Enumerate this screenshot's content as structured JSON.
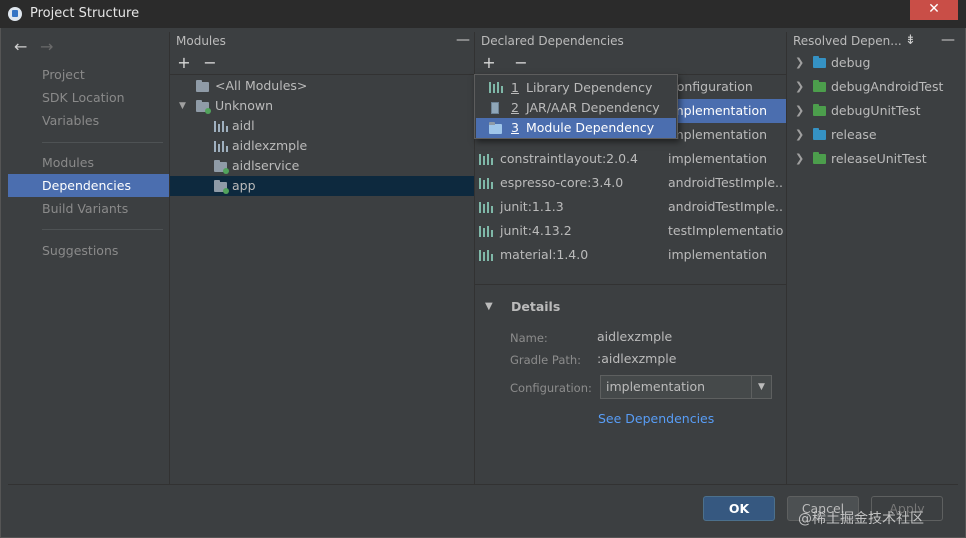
{
  "window": {
    "title": "Project Structure",
    "close_icon": "✕"
  },
  "nav": {
    "back_icon": "←",
    "forward_icon": "→",
    "items": [
      "Project",
      "SDK Location",
      "Variables",
      "Modules",
      "Dependencies",
      "Build Variants",
      "Suggestions"
    ],
    "selected": "Dependencies"
  },
  "modules_panel": {
    "header": "Modules",
    "add_label": "+",
    "remove_label": "−",
    "collapse_label": "—",
    "tree": [
      "<All Modules>",
      "Unknown",
      "aidl",
      "aidlexzmple",
      "aidlservice",
      "app"
    ],
    "selected": "app"
  },
  "declared_panel": {
    "header": "Declared Dependencies",
    "add_label": "+",
    "remove_label": "−",
    "column_configuration": "Configuration",
    "rows": [
      {
        "name": "",
        "conf": "implementation"
      },
      {
        "name": "",
        "conf": "implementation"
      },
      {
        "name": "constraintlayout:2.0.4",
        "conf": "implementation"
      },
      {
        "name": "espresso-core:3.4.0",
        "conf": "androidTestImple..."
      },
      {
        "name": "junit:1.1.3",
        "conf": "androidTestImple..."
      },
      {
        "name": "junit:4.13.2",
        "conf": "testImplementation"
      },
      {
        "name": "material:1.4.0",
        "conf": "implementation"
      }
    ],
    "details": {
      "title": "Details",
      "name_label": "Name:",
      "name_value": "aidlexzmple",
      "gradle_path_label": "Gradle Path:",
      "gradle_path_value": ":aidlexzmple",
      "configuration_label": "Configuration:",
      "configuration_value": "implementation",
      "see_dependencies": "See Dependencies"
    }
  },
  "popup_menu": {
    "items": [
      {
        "num": "1",
        "label": "Library Dependency"
      },
      {
        "num": "2",
        "label": "JAR/AAR Dependency"
      },
      {
        "num": "3",
        "label": "Module Dependency"
      }
    ],
    "selected": "Module Dependency"
  },
  "resolved_panel": {
    "header": "Resolved Depen...",
    "items": [
      {
        "label": "debug",
        "color": "#3592c4"
      },
      {
        "label": "debugAndroidTest",
        "color": "#4c9e4c"
      },
      {
        "label": "debugUnitTest",
        "color": "#4c9e4c"
      },
      {
        "label": "release",
        "color": "#3592c4"
      },
      {
        "label": "releaseUnitTest",
        "color": "#4c9e4c"
      }
    ]
  },
  "buttons": {
    "ok": "OK",
    "cancel": "Cancel",
    "apply": "Apply"
  },
  "watermark": "@稀土掘金技术社区",
  "colors": {
    "selection": "#4b6eaf",
    "link": "#589df6",
    "background": "#3c3f41"
  }
}
